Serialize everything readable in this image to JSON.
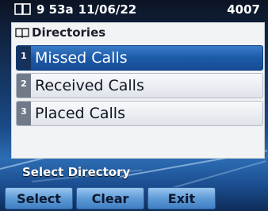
{
  "status_bar": {
    "time": "9 53a",
    "date": "11/06/22",
    "extension": "4007"
  },
  "panel": {
    "title": "Directories",
    "items": [
      {
        "number": "1",
        "label": "Missed Calls",
        "selected": true
      },
      {
        "number": "2",
        "label": "Received Calls",
        "selected": false
      },
      {
        "number": "3",
        "label": "Placed Calls",
        "selected": false
      }
    ]
  },
  "prompt": "Select Directory",
  "softkeys": [
    "Select",
    "Clear",
    "Exit"
  ]
}
